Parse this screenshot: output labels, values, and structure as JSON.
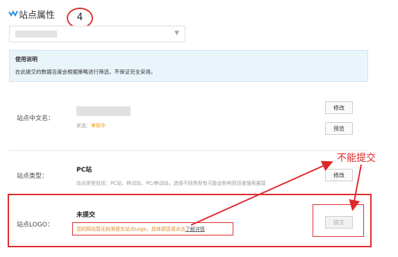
{
  "header": {
    "title": "站点属性",
    "annotation_number": "4"
  },
  "notice": {
    "title": "使用说明",
    "body": "在此提交的数据百度会根据策略进行筛选，不保证完全采用。"
  },
  "chinese_name": {
    "label": "站点中文名：",
    "status_label": "状态：",
    "status_value": "审核中",
    "edit_button": "修改",
    "preview_button": "预览"
  },
  "site_type": {
    "label": "站点类型：",
    "value": "PC站",
    "description": "站点类型包括：PC站、移动站、PC/移动站，选择不同类型有可能会影响到百度搜索展现",
    "edit_button": "修改"
  },
  "site_logo": {
    "label": "站点LOGO：",
    "value": "未提交",
    "note": "您的网站暂无权限提交站点Logo，具体原因请点击",
    "note_link": "了解详情",
    "submit_button": "提交"
  },
  "annotation": {
    "text": "不能提交",
    "color": "#e0282a"
  },
  "colors": {
    "accent": "#2a8be6",
    "status": "#f39800",
    "notice_bg": "#eaf4fb",
    "annotation": "#e0282a"
  }
}
